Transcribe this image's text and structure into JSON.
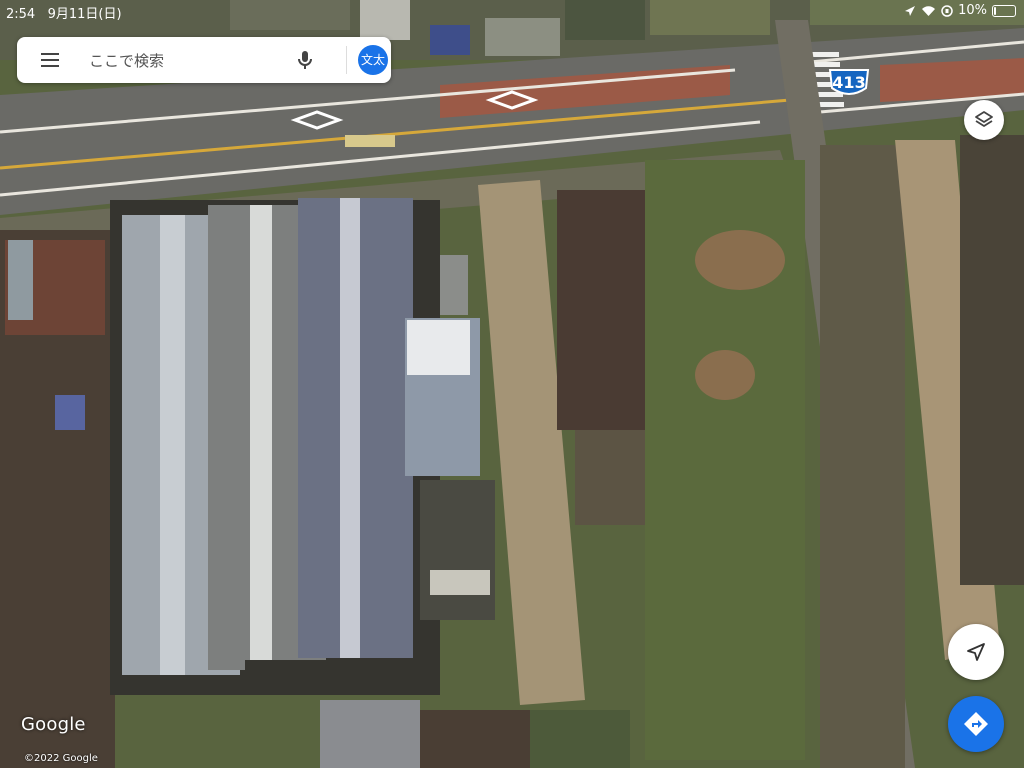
{
  "status_bar": {
    "time": "2:54",
    "date": "9月11日(日)",
    "battery_text": "10%",
    "battery_level": 0.1
  },
  "search": {
    "placeholder": "ここで検索",
    "account_label": "文太"
  },
  "route_shield": {
    "number": "413"
  },
  "map": {
    "type": "satellite",
    "logo_text": "Google",
    "copyright": "©2022 Google"
  },
  "controls": {
    "layers_icon": "layers-icon",
    "locate_icon": "navigation-arrow-icon",
    "directions_icon": "directions-icon"
  },
  "colors": {
    "accent": "#1a73e8",
    "route_shield": "#1565c0"
  }
}
